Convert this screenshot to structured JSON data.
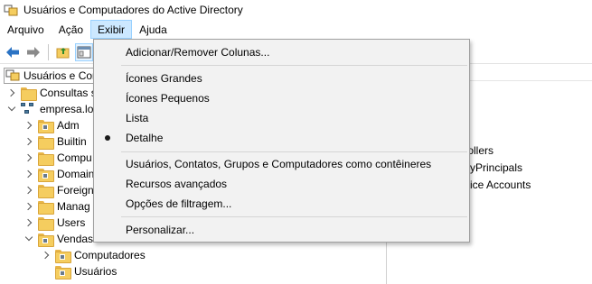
{
  "window": {
    "title": "Usuários e Computadores do Active Directory"
  },
  "menubar": {
    "items": [
      "Arquivo",
      "Ação",
      "Exibir",
      "Ajuda"
    ]
  },
  "tree": {
    "root_label": "Usuários e Con",
    "saved_queries": "Consultas s",
    "domain": "empresa.lo",
    "children": [
      "Adm",
      "Builtin",
      "Compu",
      "Domain",
      "Foreign",
      "Manag",
      "Users",
      "Vendas"
    ],
    "vendas_children": [
      "Computadores",
      "Usuários"
    ]
  },
  "right_pane": {
    "items": [
      "trollers",
      "rityPrincipals",
      "rvice Accounts"
    ]
  },
  "view_menu": {
    "add_remove_columns": "Adicionar/Remover Colunas...",
    "large_icons": "Ícones Grandes",
    "small_icons": "Ícones Pequenos",
    "list": "Lista",
    "detail": "Detalhe",
    "users_as_containers": "Usuários, Contatos, Grupos e Computadores como contêineres",
    "advanced_features": "Recursos avançados",
    "filter_options": "Opções de filtragem...",
    "customize": "Personalizar..."
  },
  "colors": {
    "menu_highlight": "#cce8ff",
    "folder": "#f5cd5f",
    "back_arrow": "#2b73c4"
  }
}
